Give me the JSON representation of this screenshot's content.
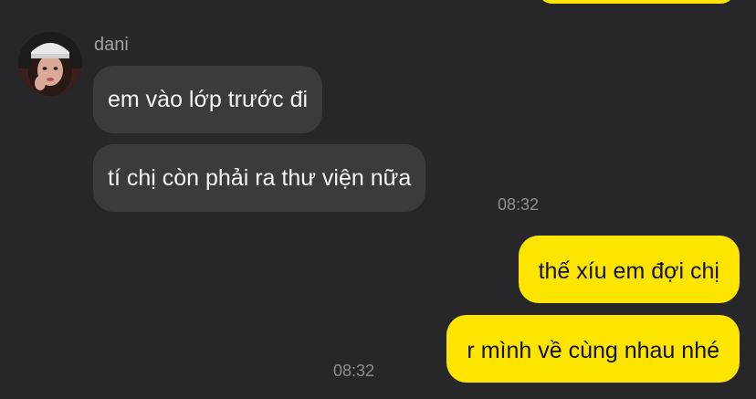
{
  "chat": {
    "sender": {
      "name": "dani",
      "avatar": "profile-photo-avatar"
    },
    "messages": [
      {
        "direction": "incoming",
        "text": "em vào lớp trước đi"
      },
      {
        "direction": "incoming",
        "text": "tí chị còn phải ra thư viện nữa"
      },
      {
        "direction": "outgoing",
        "text": "thế xíu em đợi chị"
      },
      {
        "direction": "outgoing",
        "text": "r mình về cùng nhau nhé"
      }
    ],
    "timestamps": {
      "incoming_group": "08:32",
      "outgoing_group": "08:32"
    }
  },
  "colors": {
    "background": "#27272a",
    "incoming_bubble": "#3b3b3e",
    "outgoing_bubble": "#fde500",
    "incoming_text": "#f4f4f5",
    "outgoing_text": "#111111",
    "timestamp": "#8e8e93"
  }
}
